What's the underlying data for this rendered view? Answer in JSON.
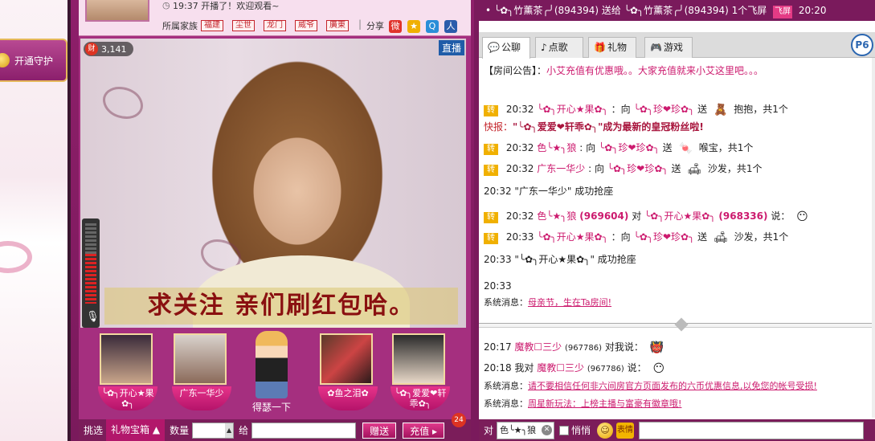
{
  "guard": {
    "label": "开通守护"
  },
  "host": {
    "time": "19:37",
    "status": "开播了！欢迎观看~",
    "family_label": "所属家族",
    "family_tags": [
      "福建",
      "尘世",
      "龙门",
      "威爷",
      "廣東"
    ],
    "share_label": "分享"
  },
  "video": {
    "wealth_icon": "财",
    "wealth_value": "3,141",
    "live_label": "直播",
    "caption": "求关注 亲们刷红包哈。",
    "volume_level": 0.62
  },
  "seats": [
    {
      "name": "╰✿╮开心★果✿╮"
    },
    {
      "name": "广东一华少"
    },
    {
      "name": "得瑟一下"
    },
    {
      "name": "✿鱼之泪✿"
    },
    {
      "name": "╰✿╮爱爱❤轩乖✿╮"
    }
  ],
  "gift_bar": {
    "pick_label": "挑选",
    "gift_box_label": "礼物宝箱",
    "qty_label": "数量",
    "to_label": "给",
    "send_label": "赠送",
    "recharge_label": "充值",
    "badge_count": "24",
    "wealth_icon": "财"
  },
  "marquee": {
    "text1": "╰✿╮竹薰茶╭╯(894394) 送给 ╰✿╮竹薰茶╭╯(894394) 1个飞屏",
    "flyscreen": "飞屏",
    "time": "20:20"
  },
  "tabs": [
    {
      "label": "公聊",
      "icon": "chat-icon"
    },
    {
      "label": "点歌",
      "icon": "music-icon"
    },
    {
      "label": "礼物",
      "icon": "gift-icon"
    },
    {
      "label": "游戏",
      "icon": "gamepad-icon"
    }
  ],
  "p6_label": "P6",
  "chat_upper": {
    "announce_label": "【房间公告】：",
    "announce_text": "小艾充值有优惠哦。。大家充值就来小艾这里吧。。。",
    "m1": {
      "time": "20:32",
      "from": "╰✿╮开心★果✿╮",
      "mid": "：向",
      "to": "╰✿╮珍❤珍✿╮",
      "send": "送",
      "gift": "抱抱，共1个"
    },
    "flash": {
      "label": "快报：",
      "text": "\"╰✿╮爱爱❤轩乖✿╮\"成为最新的皇冠粉丝啦!"
    },
    "m2": {
      "time": "20:32",
      "from": "色╰★╮狼",
      "mid": ": 向",
      "to": "╰✿╮珍❤珍✿╮",
      "send": "送",
      "gift": "喉宝，共1个"
    },
    "m3": {
      "time": "20:32",
      "from": "广东一华少",
      "mid": ": 向",
      "to": "╰✿╮珍❤珍✿╮",
      "send": "送",
      "gift": "沙发，共1个"
    },
    "m4": {
      "text": "20:32 \"广东一华少\" 成功抢座"
    },
    "m5": {
      "time": "20:32",
      "from": "色╰★╮狼",
      "from_id": "(969604)",
      "mid": "对",
      "to": "╰✿╮开心★果✿╮",
      "to_id": "(968336)",
      "say": "说："
    },
    "m6": {
      "time": "20:33",
      "from": "╰✿╮开心★果✿╮",
      "mid": "：向",
      "to": "╰✿╮珍❤珍✿╮",
      "send": "送",
      "gift": "沙发，共1个"
    },
    "m7": {
      "text": "20:33 \"╰✿╮开心★果✿╮\" 成功抢座"
    },
    "m8": {
      "time": "20:33"
    },
    "sys1": {
      "label": "系统消息：",
      "text": "母亲节，生在Ta房间!"
    }
  },
  "chat_lower": {
    "l1": {
      "time": "20:17",
      "from": "魔教☐三少",
      "id": "(967786)",
      "say": "对我说："
    },
    "l2": {
      "time": "20:18",
      "me": "我对",
      "to": "魔教☐三少",
      "id": "(967786)",
      "say": "说："
    },
    "sys2": {
      "label": "系统消息：",
      "text": "请不要相信任何非六间房官方页面发布的六币优惠信息,以免您的帐号受损!"
    },
    "sys3": {
      "label": "系统消息：",
      "text": "周星新玩法：上榜主播与富豪有徽章哦!"
    }
  },
  "input_bar": {
    "to_label": "对",
    "target": "色╰★╮狼",
    "whisper_label": "悄悄",
    "sticker_label": "表情"
  }
}
